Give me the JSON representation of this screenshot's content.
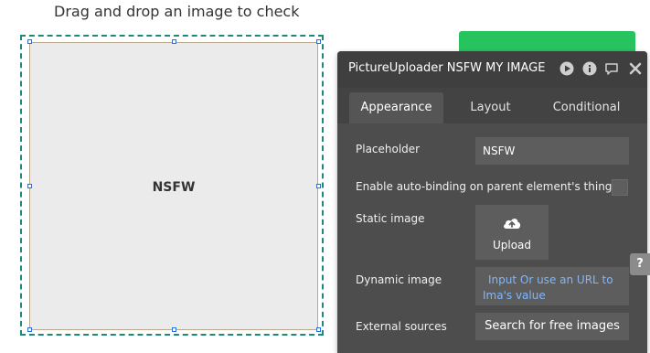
{
  "canvas": {
    "heading": "Drag and drop an image to check",
    "uploader_placeholder": "NSFW",
    "side_text": ":\n:\n:"
  },
  "panel": {
    "title": "PictureUploader NSFW MY IMAGE",
    "header_icons": [
      "play-icon",
      "info-icon",
      "comment-icon",
      "close-icon"
    ],
    "tabs": [
      {
        "label": "Appearance",
        "active": true
      },
      {
        "label": "Layout",
        "active": false
      },
      {
        "label": "Conditional",
        "active": false
      }
    ],
    "placeholder": {
      "label": "Placeholder",
      "value": "NSFW"
    },
    "auto_binding": {
      "label": "Enable auto-binding on parent element's thing",
      "checked": false
    },
    "static_image": {
      "label": "Static image",
      "button_label": "Upload",
      "icon": "cloud-upload-icon"
    },
    "dynamic_image": {
      "label": "Dynamic image",
      "line1": "Input Or use an URL to",
      "line2": "Ima's value"
    },
    "external_sources": {
      "label": "External sources",
      "button_label": "Search for free images"
    },
    "help_label": "?"
  },
  "colors": {
    "selection": "#1d8a78",
    "handle": "#2b6ed9",
    "accent_green": "#27c35e",
    "panel_bg": "#4d4d4d",
    "link_blue": "#7fb7ff"
  }
}
